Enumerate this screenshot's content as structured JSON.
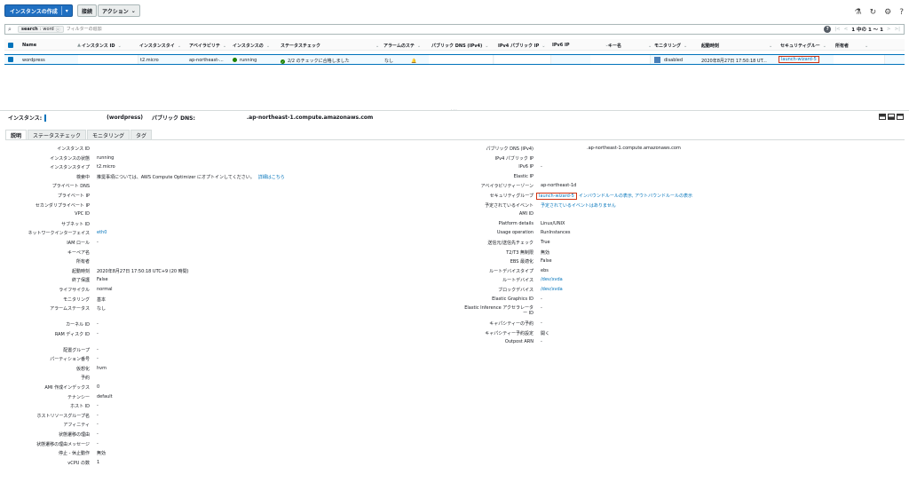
{
  "toolbar": {
    "launch_label": "インスタンスの作成",
    "connect_label": "接続",
    "actions_label": "アクション"
  },
  "search": {
    "token_key": "search",
    "token_value": "word",
    "placeholder": "フィルターの追加",
    "pager_text": "1 中の 1 ～ 1"
  },
  "table": {
    "headers": {
      "name": "Name",
      "instance_id": "インスタンス ID",
      "instance_type": "インスタンスタイ",
      "az": "アベイラビリテ",
      "state": "インスタンスの",
      "status_check": "ステータスチェック",
      "alarm": "アラームのステ",
      "public_dns": "パブリック DNS (IPv4)",
      "ipv4": "IPv4 パブリック IP",
      "ipv6": "IPv6 IP",
      "key_name": "キー名",
      "monitoring": "モニタリング",
      "launch_time": "起動時刻",
      "security_group": "セキュリティグルー",
      "owner": "所有者"
    },
    "row": {
      "name": "wordpress",
      "instance_type": "t2.micro",
      "az": "ap-northeast-...",
      "state": "running",
      "status_check": "2/2 のチェックに合格しました",
      "alarm": "なし",
      "monitoring": "disabled",
      "launch_time": "2020年8月27日 17:50:18 UT...",
      "security_group": "launch-wizard-5"
    }
  },
  "details": {
    "header": {
      "instance_label": "インスタンス:",
      "name": "(wordpress)",
      "dns_label": "パブリック DNS:",
      "dns": ".ap-northeast-1.compute.amazonaws.com"
    },
    "tabs": [
      "説明",
      "ステータスチェック",
      "モニタリング",
      "タグ"
    ],
    "left": [
      {
        "label": "インスタンス ID",
        "value": ""
      },
      {
        "label": "インスタンスの状態",
        "value": "running"
      },
      {
        "label": "インスタンスタイプ",
        "value": "t2.micro"
      },
      {
        "label": "検索中",
        "value": "推奨事項については、AWS Compute Optimizer にオプトインしてください。",
        "link": "詳細はこちら"
      },
      {
        "label": "プライベート DNS",
        "value": ""
      },
      {
        "label": "プライベート IP",
        "value": ""
      },
      {
        "label": "セカンダリプライベート IP",
        "value": ""
      },
      {
        "label": "VPC ID",
        "value": ""
      },
      {
        "label": "サブネット ID",
        "value": ""
      },
      {
        "label": "ネットワークインターフェイス",
        "value": "eth0",
        "is_link": true
      },
      {
        "label": "IAM ロール",
        "value": "-"
      },
      {
        "label": "キーペア名",
        "value": ""
      },
      {
        "label": "所有者",
        "value": ""
      },
      {
        "label": "起動時刻",
        "value": "2020年8月27日 17:50:18 UTC+9 (20 時間)"
      },
      {
        "label": "終了保護",
        "value": "False"
      },
      {
        "label": "ライフサイクル",
        "value": "normal"
      },
      {
        "label": "モニタリング",
        "value": "基本"
      },
      {
        "label": "アラームステータス",
        "value": "なし"
      },
      {
        "label": "カーネル ID",
        "value": "-"
      },
      {
        "label": "RAM ディスク ID",
        "value": "-"
      },
      {
        "label": "配置グループ",
        "value": "-"
      },
      {
        "label": "パーティション番号",
        "value": "-"
      },
      {
        "label": "仮想化",
        "value": "hvm"
      },
      {
        "label": "予約",
        "value": ""
      },
      {
        "label": "AMI 作成インデックス",
        "value": "0"
      },
      {
        "label": "テナンシー",
        "value": "default"
      },
      {
        "label": "ホスト ID",
        "value": "-"
      },
      {
        "label": "ホストリソースグループ名",
        "value": "-"
      },
      {
        "label": "アフィニティ",
        "value": "-"
      },
      {
        "label": "状態遷移の理由",
        "value": "-"
      },
      {
        "label": "状態遷移の理由メッセージ",
        "value": "-"
      },
      {
        "label": "停止 - 休止動作",
        "value": "無効"
      },
      {
        "label": "vCPU の数",
        "value": "1"
      }
    ],
    "right": [
      {
        "label": "パブリック DNS (IPv4)",
        "value": ".ap-northeast-1.compute.amazonaws.com"
      },
      {
        "label": "IPv4 パブリック IP",
        "value": ""
      },
      {
        "label": "IPv6 IP",
        "value": "-"
      },
      {
        "label": "Elastic IP",
        "value": ""
      },
      {
        "label": "アベイラビリティーゾーン",
        "value": "ap-northeast-1d"
      },
      {
        "label": "セキュリティグループ",
        "value": "launch-wizard-5",
        "extra": "インバウンドルールの表示, アウトバウンドルールの表示"
      },
      {
        "label": "予定されているイベント",
        "value": "予定されているイベントはありません",
        "is_link": true
      },
      {
        "label": "AMI ID",
        "value": ""
      },
      {
        "label": "Platform details",
        "value": "Linux/UNIX"
      },
      {
        "label": "Usage operation",
        "value": "RunInstances"
      },
      {
        "label": "送信元/送信先チェック",
        "value": "True"
      },
      {
        "label": "T2/T3 無制限",
        "value": "無効"
      },
      {
        "label": "EBS 最適化",
        "value": "False"
      },
      {
        "label": "ルートデバイスタイプ",
        "value": "ebs"
      },
      {
        "label": "ルートデバイス",
        "value": "/dev/xvda",
        "is_link": true
      },
      {
        "label": "ブロックデバイス",
        "value": "/dev/xvda",
        "is_link": true
      },
      {
        "label": "Elastic Graphics ID",
        "value": "-"
      },
      {
        "label": "Elastic Inference アクセラレータ",
        "label2": "ー ID",
        "value": "-"
      },
      {
        "label": "キャパシティーの予約",
        "value": "-"
      },
      {
        "label": "キャパシティー予約設定",
        "value": "開く"
      },
      {
        "label": "Outpost ARN",
        "value": "-"
      }
    ]
  }
}
